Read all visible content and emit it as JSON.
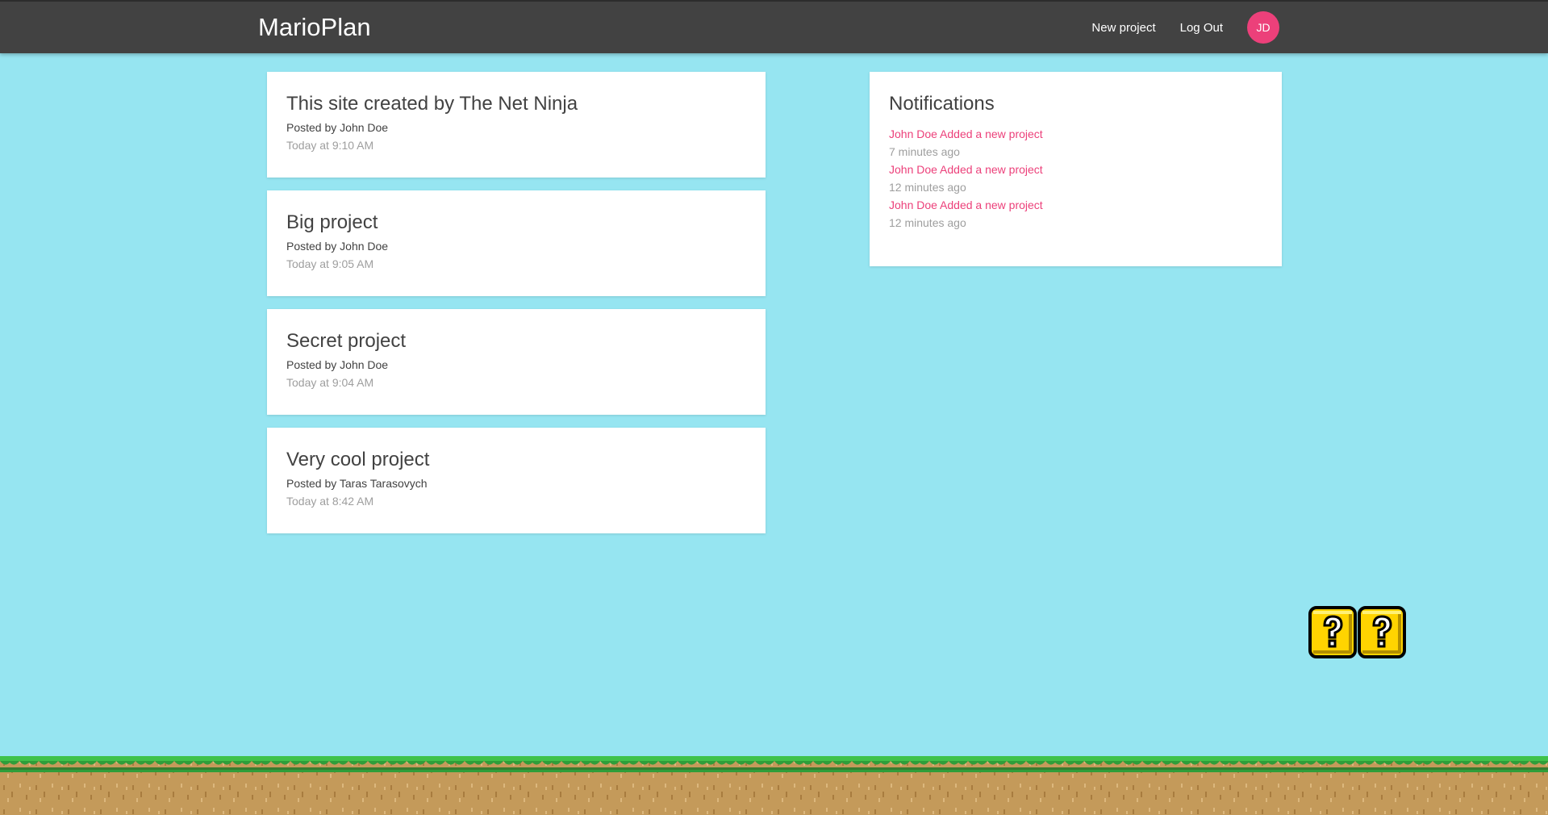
{
  "navbar": {
    "brand": "MarioPlan",
    "new_project": "New project",
    "log_out": "Log Out",
    "avatar_initials": "JD",
    "avatar_color": "#ec407a",
    "background_color": "#424242"
  },
  "projects": [
    {
      "title": "This site created by The Net Ninja",
      "author": "Posted by John Doe",
      "date": "Today at 9:10 AM"
    },
    {
      "title": "Big project",
      "author": "Posted by John Doe",
      "date": "Today at 9:05 AM"
    },
    {
      "title": "Secret project",
      "author": "Posted by John Doe",
      "date": "Today at 9:04 AM"
    },
    {
      "title": "Very cool project",
      "author": "Posted by Taras Tarasovych",
      "date": "Today at 8:42 AM"
    }
  ],
  "notifications": {
    "title": "Notifications",
    "items": [
      {
        "text": "John Doe Added a new project",
        "time": "7 minutes ago"
      },
      {
        "text": "John Doe Added a new project",
        "time": "12 minutes ago"
      },
      {
        "text": "John Doe Added a new project",
        "time": "12 minutes ago"
      }
    ],
    "accent_color": "#ec407a"
  },
  "decorations": {
    "question_blocks": [
      "question-block-icon",
      "question-block-icon"
    ],
    "ground": "grass-ground",
    "sky_color": "#96e5f1"
  }
}
